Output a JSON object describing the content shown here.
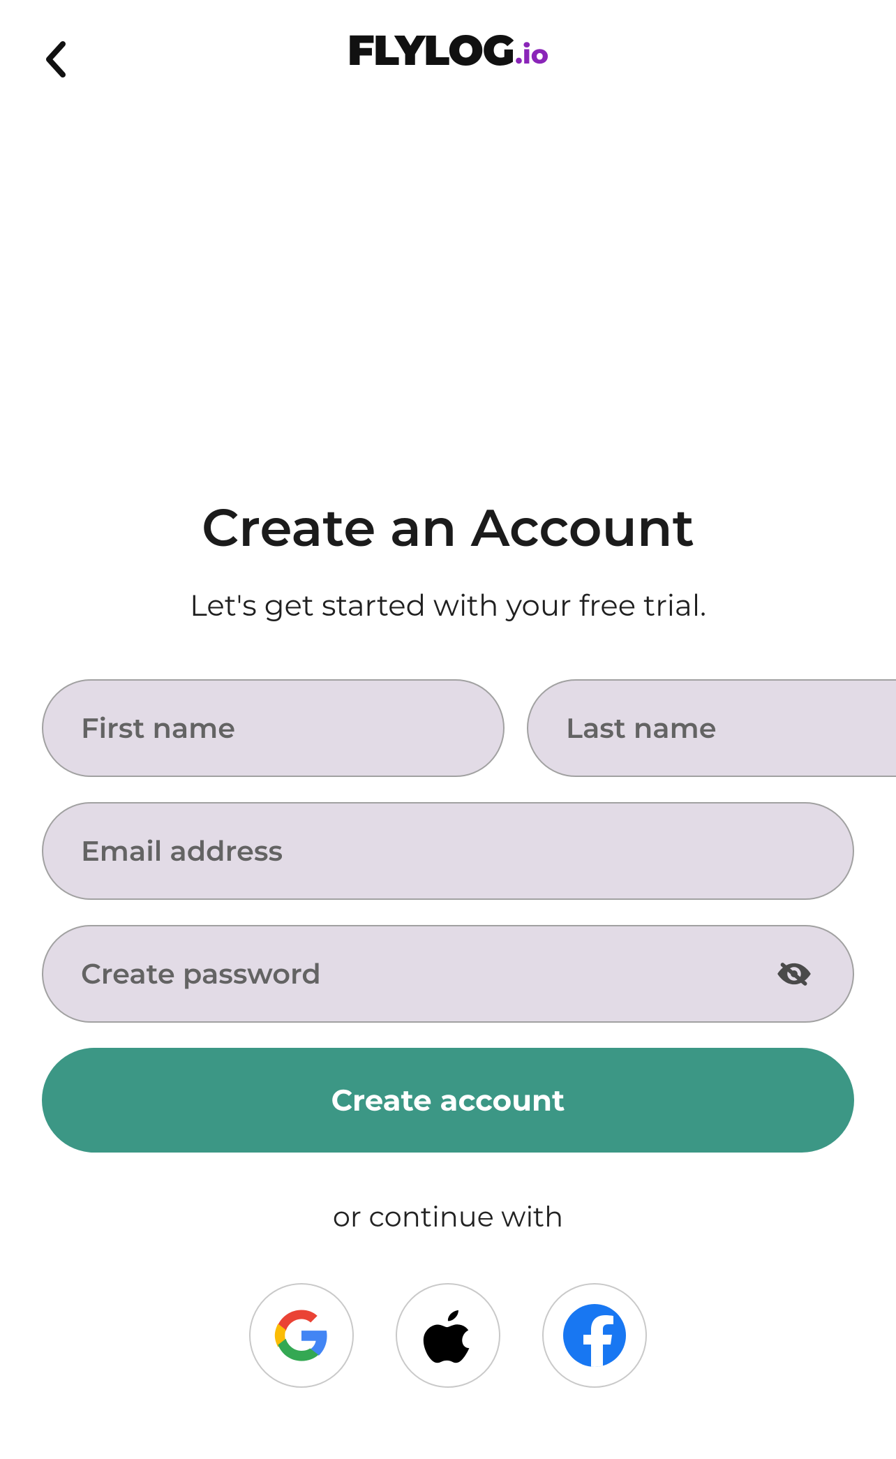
{
  "header": {
    "logo_main": "FLYLOG",
    "logo_suffix": ".io"
  },
  "hero": {
    "title": "Create an Account",
    "subtitle": "Let's get started with your free trial."
  },
  "form": {
    "first_name_placeholder": "First name",
    "last_name_placeholder": "Last name",
    "email_placeholder": "Email address",
    "password_placeholder": "Create password",
    "first_name_value": "",
    "last_name_value": "",
    "email_value": "",
    "password_value": "",
    "submit_label": "Create account"
  },
  "social": {
    "divider_text": "or continue with",
    "providers": [
      "google",
      "apple",
      "facebook"
    ]
  },
  "colors": {
    "accent": "#8a25b8",
    "primary_button": "#3c9785",
    "input_bg": "#e2dbe6",
    "facebook": "#1877F2"
  }
}
